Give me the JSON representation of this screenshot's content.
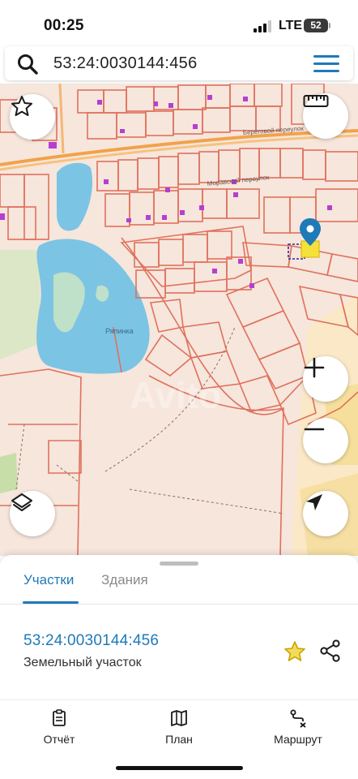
{
  "status_bar": {
    "time": "00:25",
    "network": "LTE",
    "battery": "52"
  },
  "search": {
    "query": "53:24:0030144:456",
    "search_icon": "search-icon",
    "menu_icon": "hamburger-menu-icon"
  },
  "map": {
    "watermark": "Avito",
    "lake_label": "Ряпинка",
    "street_label_1": "Береговой переулок",
    "street_label_2": "Моравский переулок",
    "colors": {
      "background": "#f6e6dc",
      "parcel_outline": "#e0705c",
      "road": "#f2a24a",
      "water": "#7cc4e4",
      "selected_parcel": "#f4e23a",
      "marker": "#1f7ab8",
      "building": "#b53fd0"
    },
    "buttons": {
      "favorite_icon": "star-outline-icon",
      "ruler_icon": "ruler-icon",
      "zoom_in_icon": "plus-icon",
      "zoom_out_icon": "minus-icon",
      "layers_icon": "layers-icon",
      "locate_icon": "navigation-arrow-icon"
    }
  },
  "sheet": {
    "tabs": [
      {
        "label": "Участки",
        "active": true
      },
      {
        "label": "Здания",
        "active": false
      }
    ],
    "result": {
      "cadastral_number": "53:24:0030144:456",
      "type": "Земельный участок",
      "favorite_color": "#e7c11a"
    }
  },
  "nav": [
    {
      "label": "Отчёт",
      "icon": "report-icon"
    },
    {
      "label": "План",
      "icon": "map-icon"
    },
    {
      "label": "Маршрут",
      "icon": "route-icon"
    }
  ]
}
